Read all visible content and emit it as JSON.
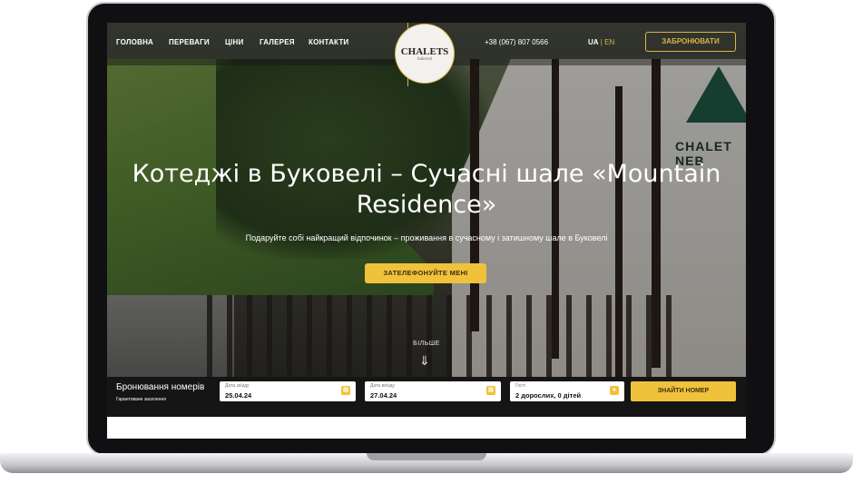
{
  "nav": {
    "items": [
      "ГОЛОВНА",
      "ПЕРЕВАГИ",
      "ЦІНИ",
      "ГАЛЕРЕЯ",
      "КОНТАКТИ"
    ],
    "logo_title": "CHALETS",
    "logo_sub": "bukovel",
    "phone": "+38 (067) 807 0566",
    "lang_active": "UA",
    "lang_sep": "|",
    "lang_other": "EN",
    "book_button": "ЗАБРОНЮВАТИ"
  },
  "hero": {
    "title": "Котеджі в Буковелі – Сучасні шале «Mountain Residence»",
    "subtitle": "Подаруйте собі найкращий відпочинок – проживання в сучасному і затишному шале в Буковелі",
    "cta": "ЗАТЕЛЕФОНУЙТЕ МЕНІ",
    "more": "БІЛЬШЕ",
    "sign": "CHALET NEB"
  },
  "booking": {
    "title": "Бронювання номерів",
    "subtitle": "Гарантоване заселення",
    "checkin_label": "Дата заїзду",
    "checkin_value": "25.04.24",
    "checkout_label": "Дата виїзду",
    "checkout_value": "27.04.24",
    "guests_label": "Гості",
    "guests_value": "2 дорослих, 0 дітей",
    "find_button": "ЗНАЙТИ НОМЕР"
  },
  "colors": {
    "accent": "#f0c23b",
    "gold_outline": "#d9b44a",
    "dark": "#151515"
  }
}
